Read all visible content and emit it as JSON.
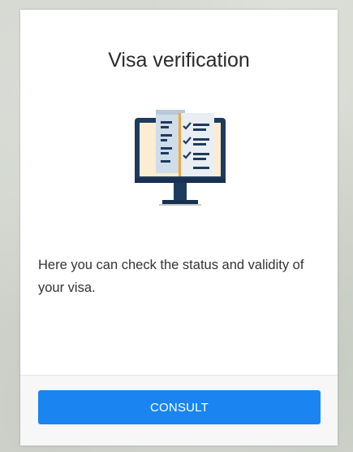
{
  "card": {
    "title": "Visa verification",
    "illustration_icon": "computer-checklist-icon",
    "description": "Here you can check the status and validity of your visa.",
    "button_label": "CONSULT"
  },
  "colors": {
    "accent": "#1a85f0",
    "illustration_navy": "#1f3a5f",
    "illustration_orange": "#f5a43a",
    "illustration_cream": "#fbecd2"
  }
}
